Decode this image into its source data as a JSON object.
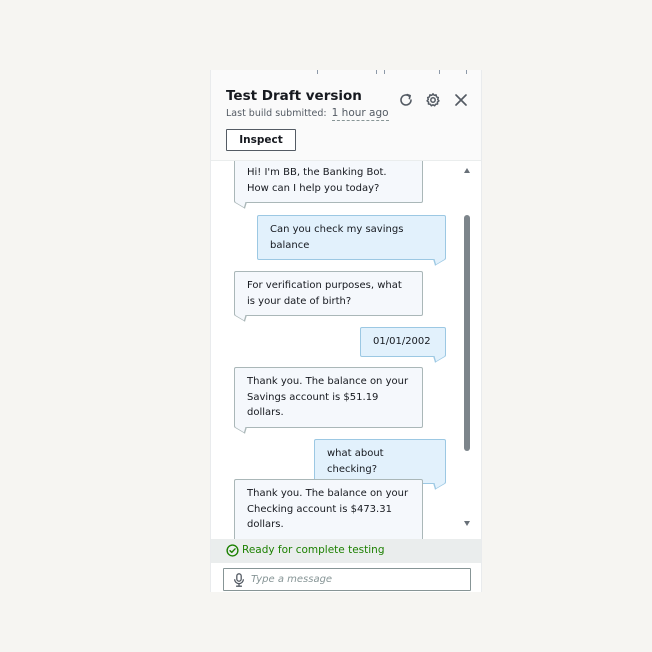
{
  "header": {
    "title": "Test Draft version",
    "last_build_label": "Last build submitted:",
    "last_build_value": "1 hour ago",
    "inspect_label": "Inspect",
    "icons": [
      "refresh-icon",
      "settings-icon",
      "close-icon"
    ]
  },
  "messages": [
    {
      "from": "bot",
      "text": "Hi! I'm BB, the Banking Bot. How can I help you today?"
    },
    {
      "from": "user",
      "text": "Can you check my savings balance"
    },
    {
      "from": "bot",
      "text": "For verification purposes, what is your date of birth?"
    },
    {
      "from": "user",
      "text": "01/01/2002"
    },
    {
      "from": "bot",
      "text": "Thank you. The balance on your Savings account is $51.19 dollars."
    },
    {
      "from": "user",
      "text": "what about checking?"
    },
    {
      "from": "bot",
      "text": "Thank you. The balance on your Checking account is $473.31 dollars."
    }
  ],
  "status": {
    "text": "Ready for complete testing",
    "color": "#1d8102"
  },
  "input": {
    "placeholder": "Type a message",
    "value": ""
  },
  "colors": {
    "bot_bubble": "#f5f8fc",
    "user_bubble": "#e2f1fc",
    "status_bar": "#eaeded"
  }
}
